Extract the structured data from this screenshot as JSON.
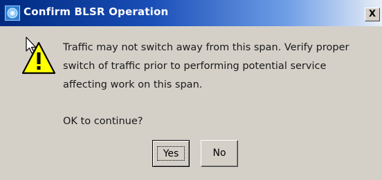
{
  "window": {
    "title": "Confirm BLSR Operation",
    "close_label": "X",
    "app_icon": "java-app-icon",
    "title_gradient": [
      "#002a7f",
      "#6f9ee6",
      "#e9eef7"
    ]
  },
  "dialog": {
    "icon": "warning-icon",
    "message": "Traffic may not switch away from this span. Verify proper switch of traffic prior to performing potential service affecting work on this span.",
    "prompt": "OK to continue?",
    "background": "#d4d0c8"
  },
  "buttons": {
    "yes_label": "Yes",
    "no_label": "No",
    "default": "Yes"
  }
}
